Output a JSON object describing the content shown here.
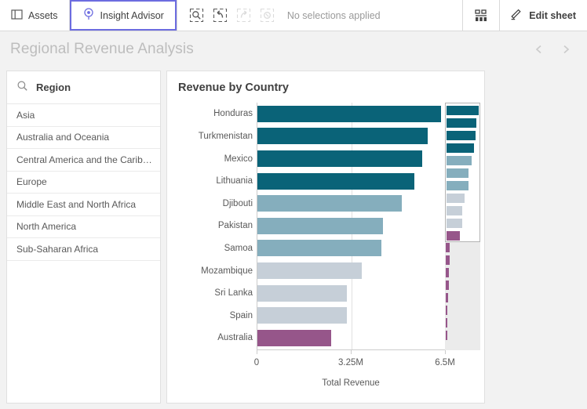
{
  "toolbar": {
    "assets_label": "Assets",
    "assets_icon": "panel-icon",
    "insight_advisor_label": "Insight Advisor",
    "insight_advisor_icon": "lightbulb-pin-icon",
    "active_tab": "Insight Advisor",
    "active_tab_border_color": "#6c6ce0",
    "selection_search_icon": "selection-search-icon",
    "selection_back_icon": "selection-step-back-icon",
    "selection_forward_icon": "selection-step-forward-icon",
    "selection_clear_icon": "clear-all-selections-icon",
    "status_text": "No selections applied",
    "sheet_grid_icon": "sheet-grid-icon",
    "edit_sheet_label": "Edit sheet",
    "edit_sheet_icon": "pencil-icon"
  },
  "sheet": {
    "title": "Regional Revenue Analysis",
    "prev_icon": "chevron-left-icon",
    "next_icon": "chevron-right-icon"
  },
  "filter_pane": {
    "search_icon": "search-icon",
    "title": "Region",
    "items": [
      {
        "label": "Asia"
      },
      {
        "label": "Australia and Oceania"
      },
      {
        "label": "Central America and the Carib…"
      },
      {
        "label": "Europe"
      },
      {
        "label": "Middle East and North Africa"
      },
      {
        "label": "North America"
      },
      {
        "label": "Sub-Saharan Africa"
      }
    ]
  },
  "colors": {
    "dark_teal": "#0a6378",
    "mid_blue": "#85aebd",
    "light_blue_gray": "#c6cfd8",
    "purple": "#96568a",
    "grid": "#e0e0e0",
    "axis": "#cccccc",
    "minimap_track": "#ebebeb"
  },
  "chart_data": {
    "type": "bar",
    "orientation": "horizontal",
    "title": "Revenue by Country",
    "xlabel": "Total Revenue",
    "ylabel": "",
    "xlim": [
      0,
      6500000
    ],
    "xticks": [
      0,
      3250000,
      6500000
    ],
    "xtick_labels": [
      "0",
      "3.25M",
      "6.5M"
    ],
    "grid": true,
    "legend": false,
    "categories": [
      "Honduras",
      "Turkmenistan",
      "Mexico",
      "Lithuania",
      "Djibouti",
      "Pakistan",
      "Samoa",
      "Mozambique",
      "Sri Lanka",
      "Spain",
      "Australia"
    ],
    "values": [
      6330000,
      5870000,
      5680000,
      5410000,
      4970000,
      4320000,
      4270000,
      3610000,
      3100000,
      3100000,
      2550000
    ],
    "bar_colors": [
      "#0a6378",
      "#0a6378",
      "#0a6378",
      "#0a6378",
      "#85aebd",
      "#85aebd",
      "#85aebd",
      "#c6cfd8",
      "#c6cfd8",
      "#c6cfd8",
      "#96568a"
    ],
    "partial_row_value": 790000,
    "partial_row_color": "#96568a",
    "total_rows": 19,
    "visible_rows": 11
  },
  "minimap": {
    "window_rows": 11,
    "offscreen_rows": 8,
    "offscreen_values": [
      760000,
      700000,
      640000,
      560000,
      470000,
      370000,
      300000,
      120000
    ],
    "offscreen_color": "#96568a"
  }
}
